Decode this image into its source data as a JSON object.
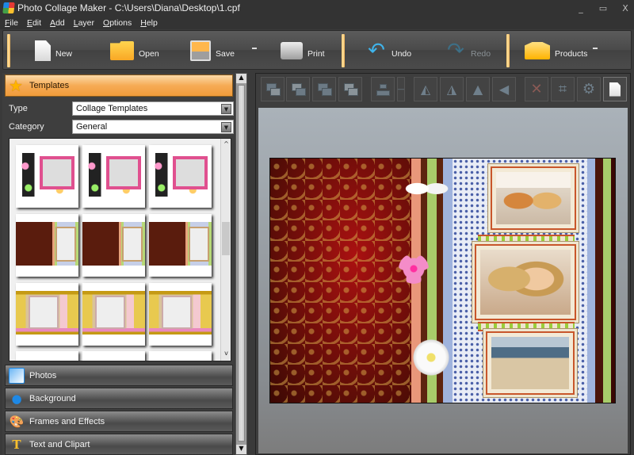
{
  "window": {
    "title": "Photo Collage Maker - C:\\Users\\Diana\\Desktop\\1.cpf",
    "controls": {
      "minimize": "_",
      "maximize": "▭",
      "close": "X"
    }
  },
  "menubar": {
    "items": [
      {
        "label": "File",
        "accel": "F",
        "rest": "ile"
      },
      {
        "label": "Edit",
        "accel": "E",
        "rest": "dit"
      },
      {
        "label": "Add",
        "accel": "A",
        "rest": "dd"
      },
      {
        "label": "Layer",
        "accel": "L",
        "rest": "ayer"
      },
      {
        "label": "Options",
        "accel": "O",
        "rest": "ptions"
      },
      {
        "label": "Help",
        "accel": "H",
        "rest": "elp"
      }
    ]
  },
  "toolbar": {
    "new_label": "New",
    "open_label": "Open",
    "save_label": "Save",
    "print_label": "Print",
    "undo_label": "Undo",
    "redo_label": "Redo",
    "products_label": "Products",
    "undo_glyph": "↶",
    "redo_glyph": "↷"
  },
  "left_panel": {
    "templates_header": "Templates",
    "star_glyph": "★",
    "type_label": "Type",
    "type_value": "Collage Templates",
    "category_label": "Category",
    "category_value": "General",
    "dropdown_glyph": "▼",
    "gallery": {
      "scroll_up": "^",
      "scroll_down": "v",
      "templates": [
        {
          "style": "flower"
        },
        {
          "style": "flower"
        },
        {
          "style": "flower"
        },
        {
          "style": "damask"
        },
        {
          "style": "damask"
        },
        {
          "style": "damask"
        },
        {
          "style": "gold"
        },
        {
          "style": "gold"
        },
        {
          "style": "gold"
        }
      ]
    },
    "sections": [
      {
        "label": "Photos",
        "icon": "photos-icon"
      },
      {
        "label": "Background",
        "icon": "background-icon"
      },
      {
        "label": "Frames and Effects",
        "icon": "palette-icon"
      },
      {
        "label": "Text and Clipart",
        "icon": "text-icon"
      }
    ],
    "section_glyphs": {
      "photos": "",
      "background": "●",
      "frames": "🎨",
      "text": "T"
    }
  },
  "scrollbar": {
    "up": "▲",
    "down": "▼"
  },
  "edit_toolbar": {
    "tools": [
      "send-to-back",
      "send-backward",
      "bring-forward",
      "bring-to-front",
      "align",
      "align-dropdown",
      "rotate-left",
      "rotate-right",
      "flip-horizontal",
      "flip-vertical",
      "delete",
      "crop",
      "settings",
      "page"
    ],
    "glyphs": {
      "delete": "✕",
      "crop": "⌗",
      "settings": "⚙",
      "align_dd": "—"
    }
  }
}
